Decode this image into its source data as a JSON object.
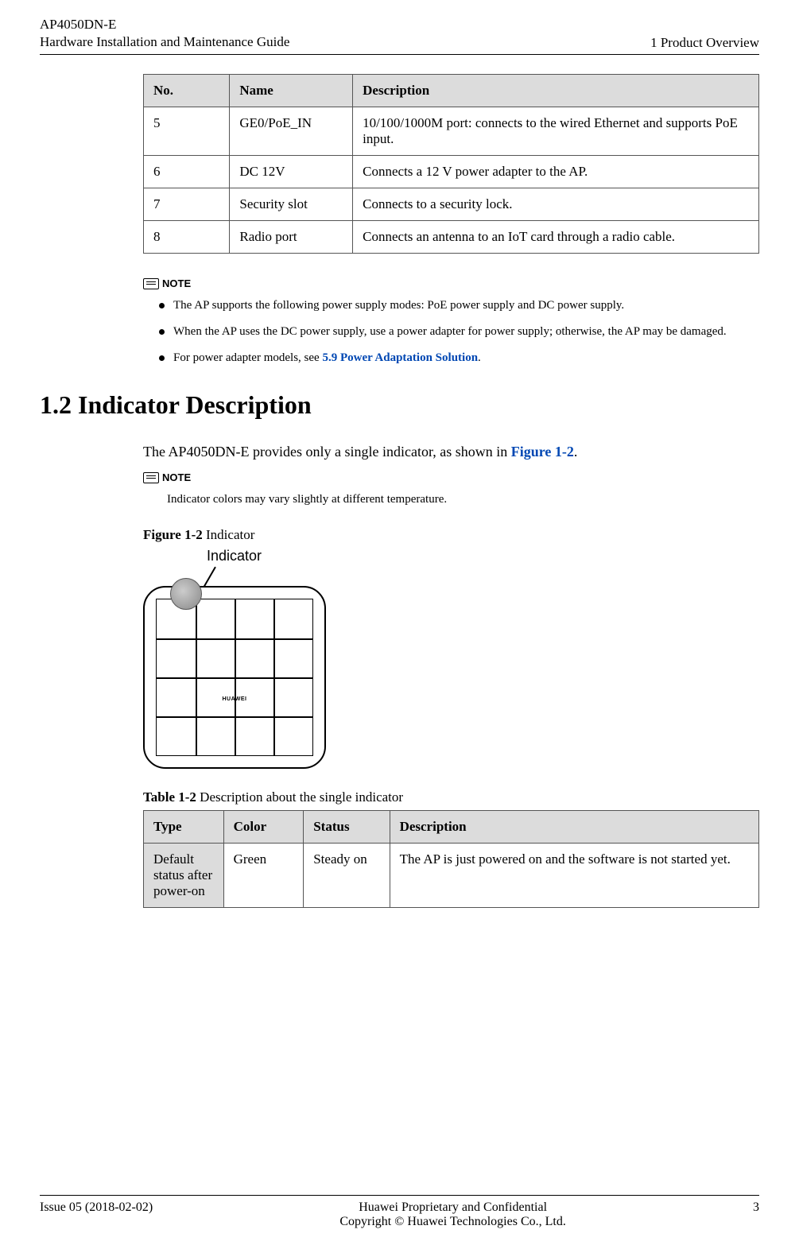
{
  "header": {
    "product": "AP4050DN-E",
    "doc_title": "Hardware Installation and Maintenance Guide",
    "chapter": "1 Product Overview"
  },
  "table1": {
    "headers": {
      "no": "No.",
      "name": "Name",
      "desc": "Description"
    },
    "rows": [
      {
        "no": "5",
        "name": "GE0/PoE_IN",
        "desc": "10/100/1000M port: connects to the wired Ethernet and supports PoE input."
      },
      {
        "no": "6",
        "name": "DC 12V",
        "desc": "Connects a 12 V power adapter to the AP."
      },
      {
        "no": "7",
        "name": "Security slot",
        "desc": "Connects to a security lock."
      },
      {
        "no": "8",
        "name": "Radio port",
        "desc": "Connects an antenna to an IoT card through a radio cable."
      }
    ]
  },
  "note1": {
    "label": "NOTE",
    "items": [
      "The AP supports the following power supply modes: PoE power supply and DC power supply.",
      "When the AP uses the DC power supply, use a power adapter for power supply; otherwise, the AP may be damaged."
    ],
    "item3_prefix": "For power adapter models, see ",
    "item3_link": "5.9 Power Adaptation Solution",
    "item3_suffix": "."
  },
  "section": {
    "heading": "1.2 Indicator Description",
    "intro_prefix": "The AP4050DN-E provides only a single indicator, as shown in ",
    "intro_link": "Figure 1-2",
    "intro_suffix": "."
  },
  "note2": {
    "label": "NOTE",
    "text": "Indicator colors may vary slightly at different temperature."
  },
  "figure": {
    "caption_bold": "Figure 1-2",
    "caption_rest": " Indicator",
    "label": "Indicator",
    "brand": "HUAWEI"
  },
  "table2": {
    "caption_bold": "Table 1-2",
    "caption_rest": " Description about the single indicator",
    "headers": {
      "type": "Type",
      "color": "Color",
      "status": "Status",
      "desc": "Description"
    },
    "rows": [
      {
        "type": "Default status after power-on",
        "color": "Green",
        "status": "Steady on",
        "desc": "The AP is just powered on and the software is not started yet."
      }
    ]
  },
  "footer": {
    "issue": "Issue 05 (2018-02-02)",
    "line1": "Huawei Proprietary and Confidential",
    "line2": "Copyright © Huawei Technologies Co., Ltd.",
    "page": "3"
  }
}
